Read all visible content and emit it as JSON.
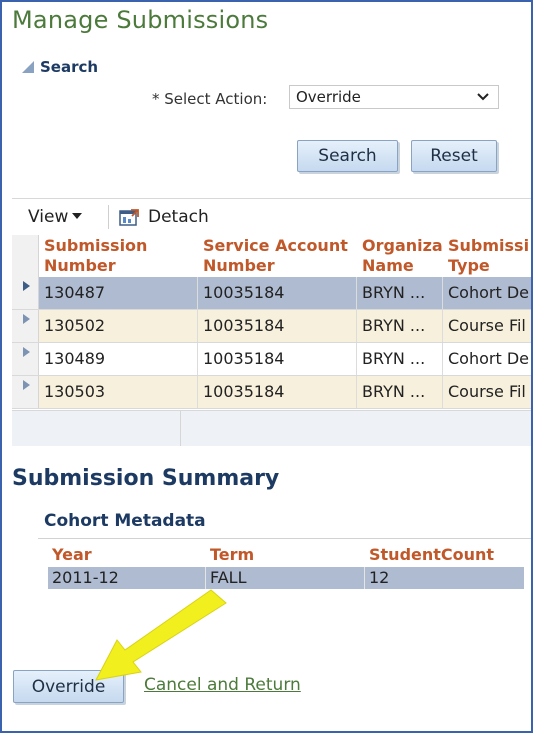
{
  "page_title": "Manage Submissions",
  "search": {
    "header": "Search",
    "action_label": "* Select Action:",
    "action_value": "Override",
    "search_button": "Search",
    "reset_button": "Reset"
  },
  "table": {
    "toolbar": {
      "view_label": "View",
      "detach_label": "Detach"
    },
    "headers": {
      "submission_number": "Submission\nNumber",
      "service_account": "Service Account\nNumber",
      "organization": "Organiza\nName",
      "submission_type": "Submissi\nType"
    },
    "rows": [
      {
        "submission_number": "130487",
        "service_account": "10035184",
        "organization": "BRYN ...",
        "submission_type": "Cohort De"
      },
      {
        "submission_number": "130502",
        "service_account": "10035184",
        "organization": "BRYN ...",
        "submission_type": "Course Fil"
      },
      {
        "submission_number": "130489",
        "service_account": "10035184",
        "organization": "BRYN ...",
        "submission_type": "Cohort De"
      },
      {
        "submission_number": "130503",
        "service_account": "10035184",
        "organization": "BRYN ...",
        "submission_type": "Course Fil"
      }
    ]
  },
  "summary": {
    "title": "Submission Summary",
    "cohort_title": "Cohort Metadata",
    "headers": {
      "year": "Year",
      "term": "Term",
      "student_count": "StudentCount"
    },
    "row": {
      "year": "2011-12",
      "term": "FALL",
      "student_count": "12"
    }
  },
  "actions": {
    "override_button": "Override",
    "cancel_link": "Cancel and Return"
  },
  "colors": {
    "title_green": "#4c7a3b",
    "header_navy": "#1d3a63",
    "column_header_orange": "#c0582a",
    "selected_row": "#aebbd0",
    "alt_row": "#f7f0dc",
    "annotation_arrow": "#f2ef1e"
  }
}
